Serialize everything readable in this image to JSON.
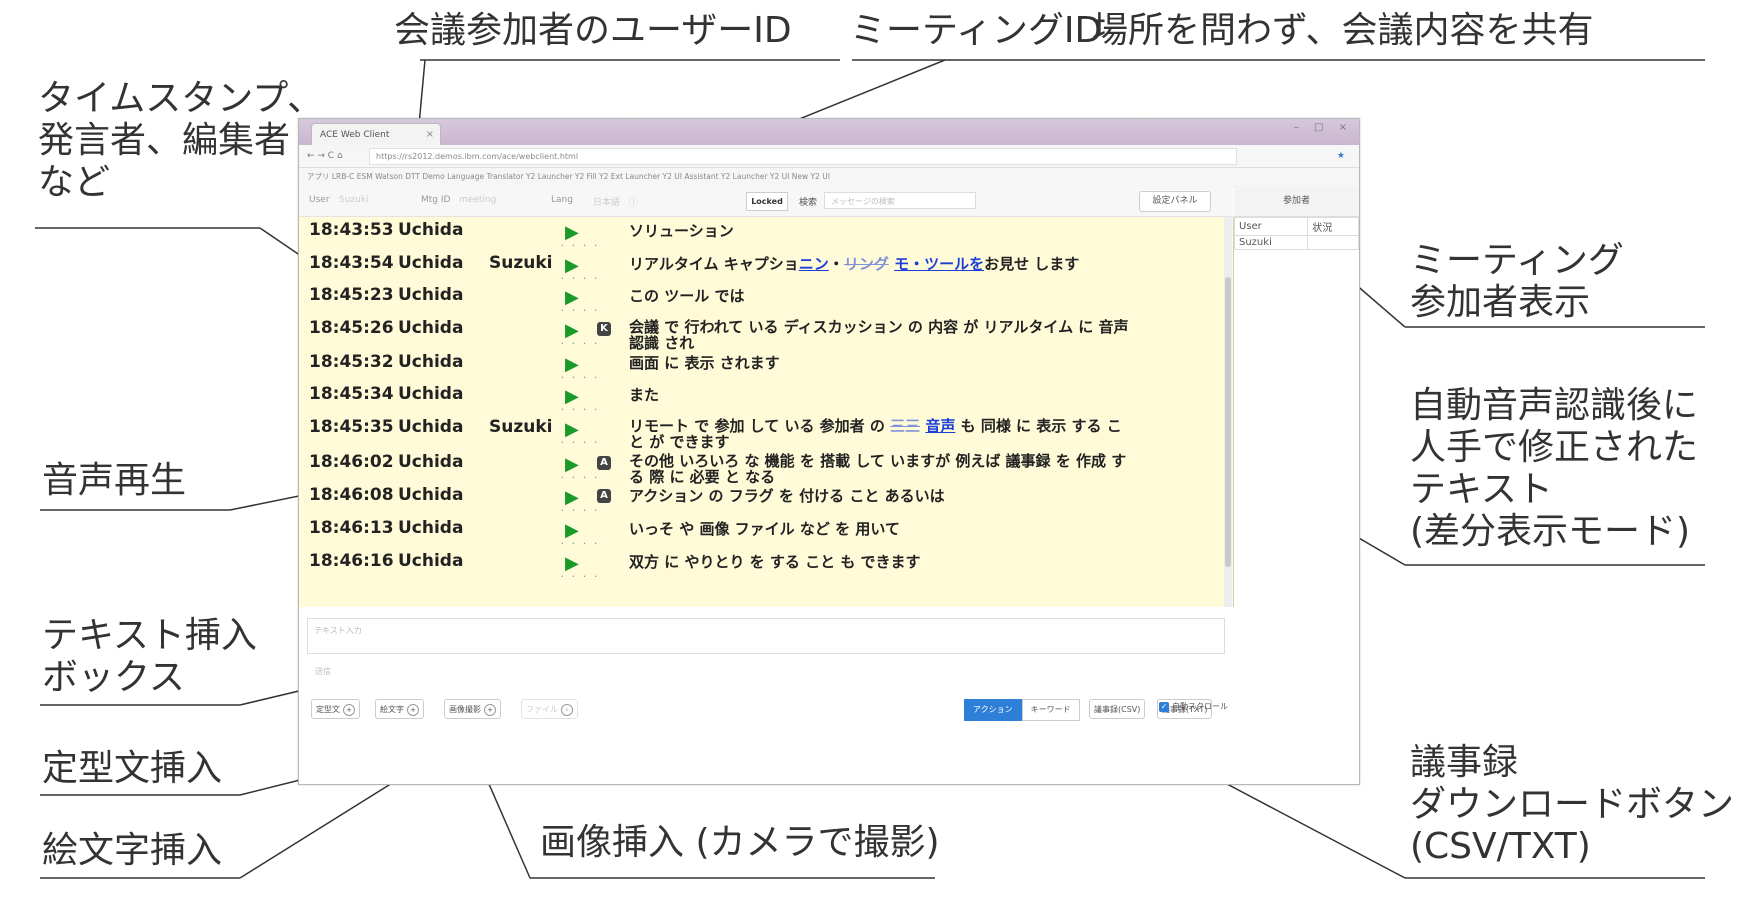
{
  "callouts": {
    "user_id": "会議参加者のユーザーID",
    "meeting_id": "ミーティングID",
    "share": "場所を問わず、会議内容を共有",
    "timestamp": "タイムスタンプ、\n発言者、編集者\nなど",
    "participants": "ミーティング\n参加者表示",
    "corrected": "自動音声認識後に\n人手で修正された\nテキスト\n(差分表示モード)",
    "playback": "音声再生",
    "text_box": "テキスト挿入\nボックス",
    "template": "定型文挿入",
    "emoji": "絵文字挿入",
    "image": "画像挿入 (カメラで撮影)",
    "download": "議事録\nダウンロードボタン\n(CSV/TXT)"
  },
  "browser": {
    "tab_title": "ACE Web Client",
    "tab_close": "×",
    "window_controls": "– □ ×",
    "nav": "← → C ⌂",
    "url": "https://rs2012.demos.ibm.com/ace/webclient.html",
    "bookmarks": "アプリ  LRB-C  ESM  Watson DTT Demo  Language Translator  Y2 Launcher  Y2 Fill  Y2 Ext  Launcher  Y2 UI  Assistant  Y2 Launcher  Y2 UI  New Y2 UI"
  },
  "toolbar": {
    "user_label": "User",
    "user_value": "Suzuki",
    "mtg_label": "Mtg ID",
    "mtg_value": "meeting",
    "lang_label": "Lang",
    "lang_value": "日本語",
    "lock_button": "Locked",
    "search_label": "検索",
    "search_placeholder": "メッセージの検索",
    "panel_button": "設定パネル"
  },
  "transcript": [
    {
      "time": "18:43:53",
      "user": "Uchida",
      "editor": "",
      "badge": "",
      "text": "ソリューション"
    },
    {
      "time": "18:43:54",
      "user": "Uchida",
      "editor": "Suzuki",
      "badge": "",
      "text_parts": [
        "リアルタイム キャプショ",
        "ニン",
        "・",
        "リング",
        " ",
        "モ・ツールを",
        "お見せ します"
      ]
    },
    {
      "time": "18:45:23",
      "user": "Uchida",
      "editor": "",
      "badge": "",
      "text": "この ツール では"
    },
    {
      "time": "18:45:26",
      "user": "Uchida",
      "editor": "",
      "badge": "K",
      "text": "会議 で 行われて いる ディスカッション の 内容 が リアルタイム に 音声 認識 され"
    },
    {
      "time": "18:45:32",
      "user": "Uchida",
      "editor": "",
      "badge": "",
      "text": "画面 に 表示 されます"
    },
    {
      "time": "18:45:34",
      "user": "Uchida",
      "editor": "",
      "badge": "",
      "text": "また"
    },
    {
      "time": "18:45:35",
      "user": "Uchida",
      "editor": "Suzuki",
      "badge": "",
      "text_parts": [
        "リモート で 参加 して いる 参加者 の ",
        "三三",
        " ",
        "音声",
        " も 同様 に 表示 する こと が できます"
      ]
    },
    {
      "time": "18:46:02",
      "user": "Uchida",
      "editor": "",
      "badge": "A",
      "text": "その他 いろいろ な 機能 を 搭載 して いますが 例えば 議事録 を 作成 する 際 に 必要 と なる"
    },
    {
      "time": "18:46:08",
      "user": "Uchida",
      "editor": "",
      "badge": "A",
      "text": "アクション の フラグ を 付ける こと あるいは"
    },
    {
      "time": "18:46:13",
      "user": "Uchida",
      "editor": "",
      "badge": "",
      "text": "いっそ や 画像 ファイル など を 用いて"
    },
    {
      "time": "18:46:16",
      "user": "Uchida",
      "editor": "",
      "badge": "",
      "text": "双方 に やりとり を する こと も できます"
    }
  ],
  "side_panel": {
    "title": "参加者",
    "col_user": "User",
    "col_status": "状況",
    "participant": "Suzuki"
  },
  "input": {
    "placeholder": "テキスト入力",
    "note": "送信"
  },
  "bottom": {
    "template_btn": "定型文",
    "emoji_btn": "絵文字",
    "image_btn": "画像撮影",
    "file_btn": "ファイル",
    "action_tab": "アクション",
    "keyword_tab": "キーワード",
    "csv_btn": "議事録(CSV)",
    "txt_btn": "議事録(TXT)",
    "autoscroll": "自動スクロール"
  },
  "icons": {
    "play": "play-icon",
    "badge": "flag-badge-icon",
    "circle": "circle-plus-icon",
    "check": "checkbox-icon"
  },
  "colors": {
    "transcript_bg": "#fffbd8",
    "diff_text": "#1a3ed8",
    "play_icon": "#1a9a2a",
    "accent": "#2d7fd8"
  }
}
